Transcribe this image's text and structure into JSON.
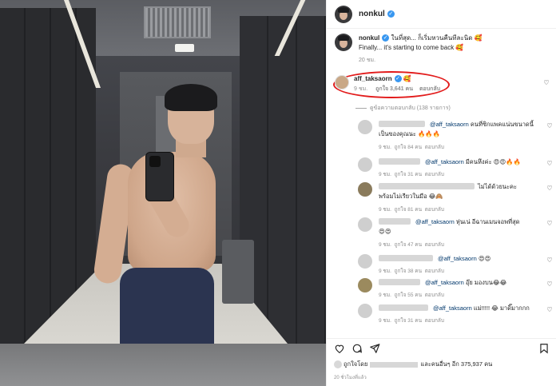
{
  "post": {
    "author": "nonkul",
    "caption_user": "nonkul",
    "caption_text": "ในที่สุด... ก็เริ่มหวนคืนทีละนิด 🥰",
    "caption_text_en": "Finally... it's starting to come back 🥰",
    "caption_time": "20 ชม."
  },
  "highlight": {
    "user": "aff_taksaorn",
    "emoji": "🥰",
    "time": "9 ชม.",
    "likes": "ถูกใจ 3,641 คน",
    "reply": "ตอบกลับ"
  },
  "view_replies": "ดูข้อความตอบกลับ (138 รายการ)",
  "replies": [
    {
      "mention": "@aff_taksaorn",
      "text": "คนที่ซิกแพคแน่นขนาดนี้",
      "text2": "เป็นของคุณนะ 🔥🔥🔥",
      "time": "9 ชม.",
      "likes": "ถูกใจ 84 คน",
      "reply": "ตอบกลับ"
    },
    {
      "mention": "@aff_taksaorn",
      "text": "มีคนหึงค่ะ 😍😍🔥🔥",
      "time": "9 ชม.",
      "likes": "ถูกใจ 31 คน",
      "reply": "ตอบกลับ"
    },
    {
      "mention": "",
      "text": "ไม่ได้ด้วยนะคะ",
      "text2": "พร้อมไม่เรียวในมือ 😂🙈",
      "time": "9 ชม.",
      "likes": "ถูกใจ 81 คน",
      "reply": "ตอบกลับ"
    },
    {
      "mention": "@aff_taksaorn",
      "text": "หุ่นเน่ อีฉานเมนจอพที่สุด",
      "text2": "😍😍",
      "time": "9 ชม.",
      "likes": "ถูกใจ 47 คน",
      "reply": "ตอบกลับ"
    },
    {
      "mention": "@aff_taksaorn",
      "text": "😍😍",
      "time": "9 ชม.",
      "likes": "ถูกใจ 38 คน",
      "reply": "ตอบกลับ"
    },
    {
      "mention": "@aff_taksaorn",
      "text": "อุ๊ย มองบน😂😂",
      "time": "9 ชม.",
      "likes": "ถูกใจ 55 คน",
      "reply": "ตอบกลับ"
    },
    {
      "mention": "@aff_taksaorn",
      "text": "แม่!!!!! 😂 มาดิ๊มากกก",
      "time": "9 ชม.",
      "likes": "ถูกใจ 31 คน",
      "reply": "ตอบกลับ"
    }
  ],
  "likes_summary": {
    "prefix": "ถูกใจโดย",
    "suffix": "และคนอื่นๆ อีก 375,937 คน"
  },
  "post_time": "20 ชั่วโมงที่แล้ว",
  "icons": [
    "heart-icon",
    "comment-icon",
    "share-icon",
    "bookmark-icon",
    "verified-icon"
  ],
  "colors": {
    "verified": "#3897f0",
    "highlight_ring": "#e21b1b",
    "mention": "#00376b",
    "muted": "#8e8e8e"
  }
}
